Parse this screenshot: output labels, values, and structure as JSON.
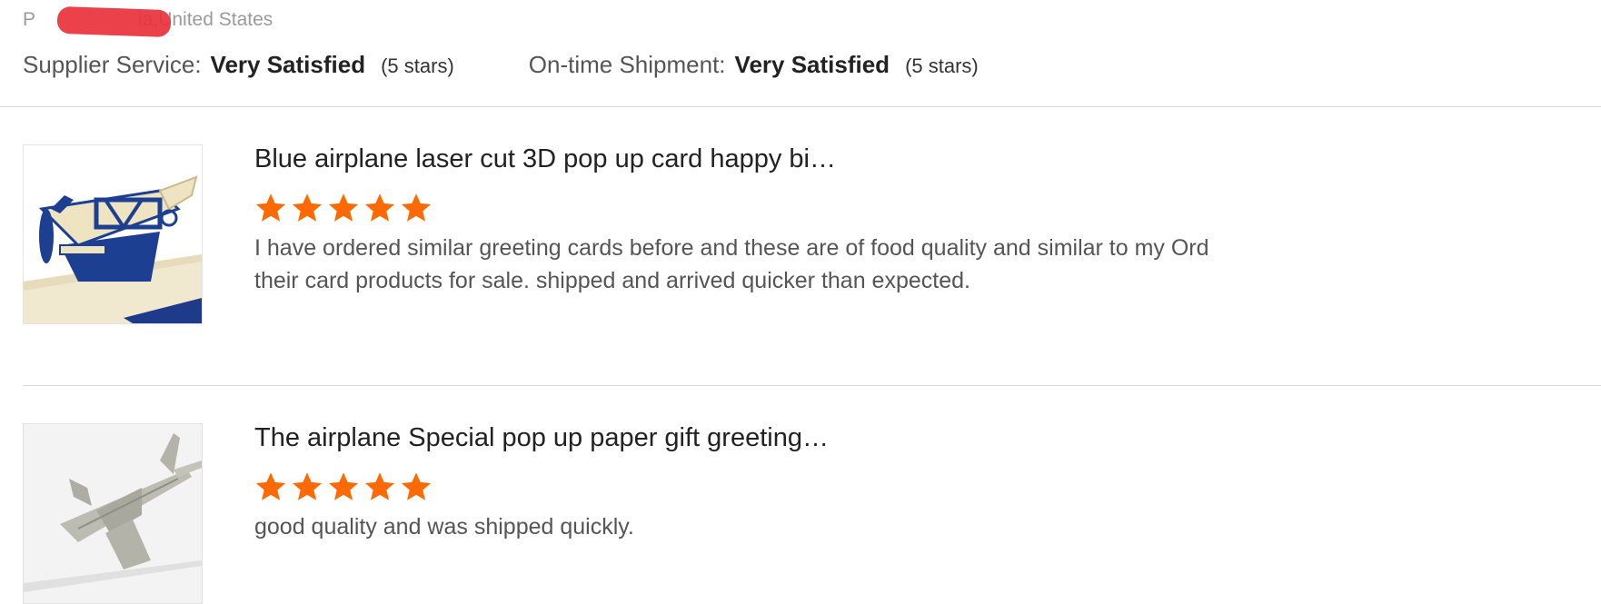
{
  "reviewer": {
    "location_prefix": "P",
    "location_suffix": "ia,United States"
  },
  "store_ratings": [
    {
      "label": "Supplier Service:",
      "value": "Very Satisfied",
      "stars_text": "(5 stars)"
    },
    {
      "label": "On-time Shipment:",
      "value": "Very Satisfied",
      "stars_text": "(5 stars)"
    }
  ],
  "reviews": [
    {
      "product_title": "Blue airplane laser cut 3D pop up card happy bi…",
      "rating": 5,
      "text": "I have ordered similar greeting cards before and these are of food quality and similar to my Ord\ntheir card products for sale. shipped and arrived quicker than expected.",
      "thumbnail_icon": "blue-biplane-popup-card"
    },
    {
      "product_title": "The airplane Special pop up paper gift greeting…",
      "rating": 5,
      "text": "good quality and was shipped quickly.",
      "thumbnail_icon": "white-jet-popup-card"
    }
  ],
  "colors": {
    "star": "#ff6a00",
    "divider": "#d9d9d9",
    "redaction": "#e8313b"
  }
}
